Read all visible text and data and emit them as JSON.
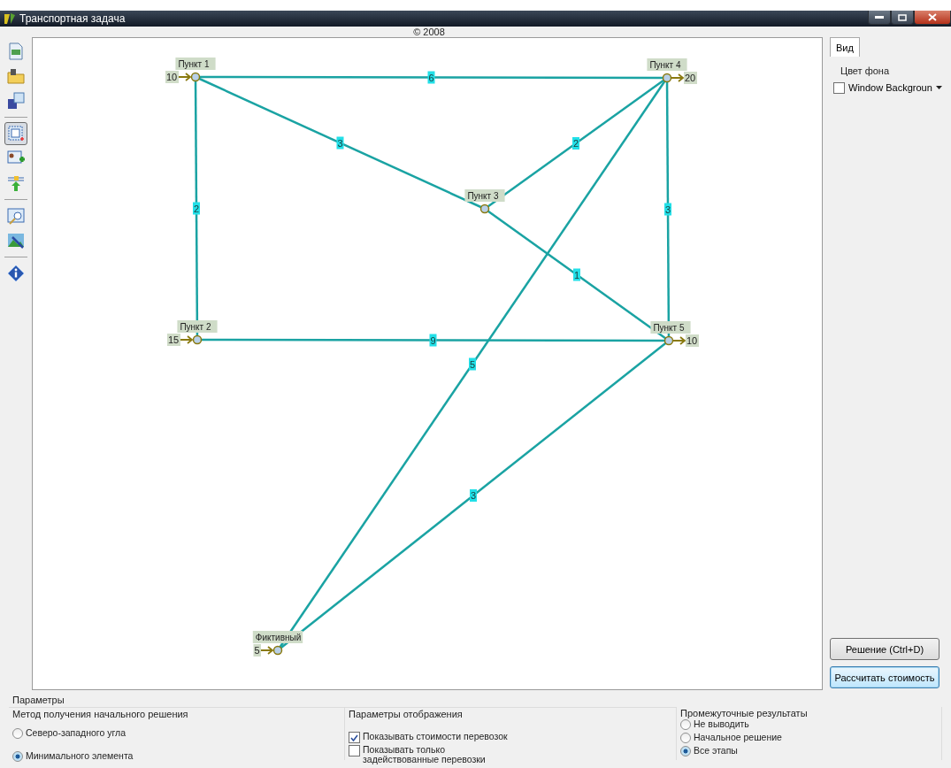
{
  "window": {
    "title": "Транспортная задача"
  },
  "copyright": "© 2008",
  "toolbar_groups": [
    [
      {
        "kind": "new",
        "selected": false
      },
      {
        "kind": "open",
        "selected": false
      },
      {
        "kind": "save",
        "selected": false
      }
    ],
    [
      {
        "kind": "text",
        "selected": true
      },
      {
        "kind": "card",
        "selected": false
      },
      {
        "kind": "node",
        "selected": false
      }
    ],
    [
      {
        "kind": "preview",
        "selected": false
      },
      {
        "kind": "image",
        "selected": false
      }
    ],
    [
      {
        "kind": "info",
        "selected": false
      }
    ]
  ],
  "nodes": [
    {
      "label": "Пункт 1",
      "amount": "10",
      "kind": "source"
    },
    {
      "label": "Пункт 4",
      "amount": "20",
      "kind": "sink"
    },
    {
      "label": "Пункт 3",
      "kind": "transit"
    },
    {
      "label": "Пункт 2",
      "amount": "15",
      "kind": "source"
    },
    {
      "label": "Пункт 5",
      "amount": "10",
      "kind": "sink"
    },
    {
      "label": "Фиктивный",
      "amount": "5",
      "kind": "source"
    }
  ],
  "edges": [
    {
      "cost": "6"
    },
    {
      "cost": "2"
    },
    {
      "cost": "3"
    },
    {
      "cost": "2"
    },
    {
      "cost": "3"
    },
    {
      "cost": "1"
    },
    {
      "cost": "9"
    },
    {
      "cost": "5"
    },
    {
      "cost": "3"
    }
  ],
  "side_panel": {
    "tab": {
      "label": "Вид",
      "selected": true
    },
    "label": "Цвет фона",
    "color_select": {
      "value": "Window Backgroun",
      "checked": false
    }
  },
  "buttons": [
    {
      "label": "Решение (Ctrl+D)",
      "focused": false
    },
    {
      "label": "Рассчитать стоимость",
      "focused": true
    }
  ],
  "parameters": {
    "title": "Параметры",
    "method": {
      "title": "Метод получения начального решения",
      "options": [
        {
          "label": "Северо-западного угла",
          "selected": false
        },
        {
          "label": "Минимального элемента",
          "selected": true
        }
      ]
    },
    "display": {
      "title": "Параметры отображения",
      "options": [
        {
          "label": "Показывать стоимости перевозок",
          "checked": true
        },
        {
          "label": "Показывать только задействованные перевозки",
          "checked": false
        }
      ]
    },
    "intermediate": {
      "title": "Промежуточные результаты",
      "options": [
        {
          "label": "Не выводить",
          "selected": false
        },
        {
          "label": "Начальное решение",
          "selected": false
        },
        {
          "label": "Все этапы",
          "selected": true
        }
      ]
    }
  }
}
